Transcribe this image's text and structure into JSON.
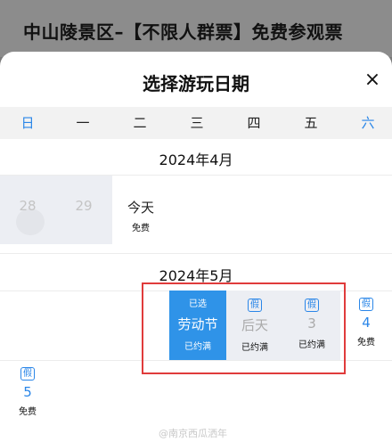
{
  "background": {
    "title": "中山陵景区–【不限人群票】免费参观票"
  },
  "sheet": {
    "title": "选择游玩日期",
    "close_icon": "×"
  },
  "weekdays": [
    "日",
    "一",
    "二",
    "三",
    "四",
    "五",
    "六"
  ],
  "april": {
    "month_label": "2024年4月",
    "days": [
      {
        "num": "28",
        "status": "past"
      },
      {
        "num": "29",
        "status": "past"
      },
      {
        "num": "今天",
        "sub": "免费"
      }
    ]
  },
  "may": {
    "month_label": "2024年5月",
    "days": [
      {
        "top": "已选",
        "num": "劳动节",
        "sub": "已约满",
        "selected": true
      },
      {
        "tag": "假",
        "num": "后天",
        "sub": "已约满"
      },
      {
        "tag": "假",
        "num": "3",
        "sub": "已约满"
      },
      {
        "tag": "假",
        "num": "4",
        "sub": "免费"
      },
      {
        "tag": "假",
        "num": "5",
        "sub": "免费"
      }
    ]
  },
  "watermark": "@南京西瓜洒年",
  "colors": {
    "accent": "#2f93e8",
    "weekend": "#2a86e8",
    "highlight_border": "#e03b3b"
  }
}
